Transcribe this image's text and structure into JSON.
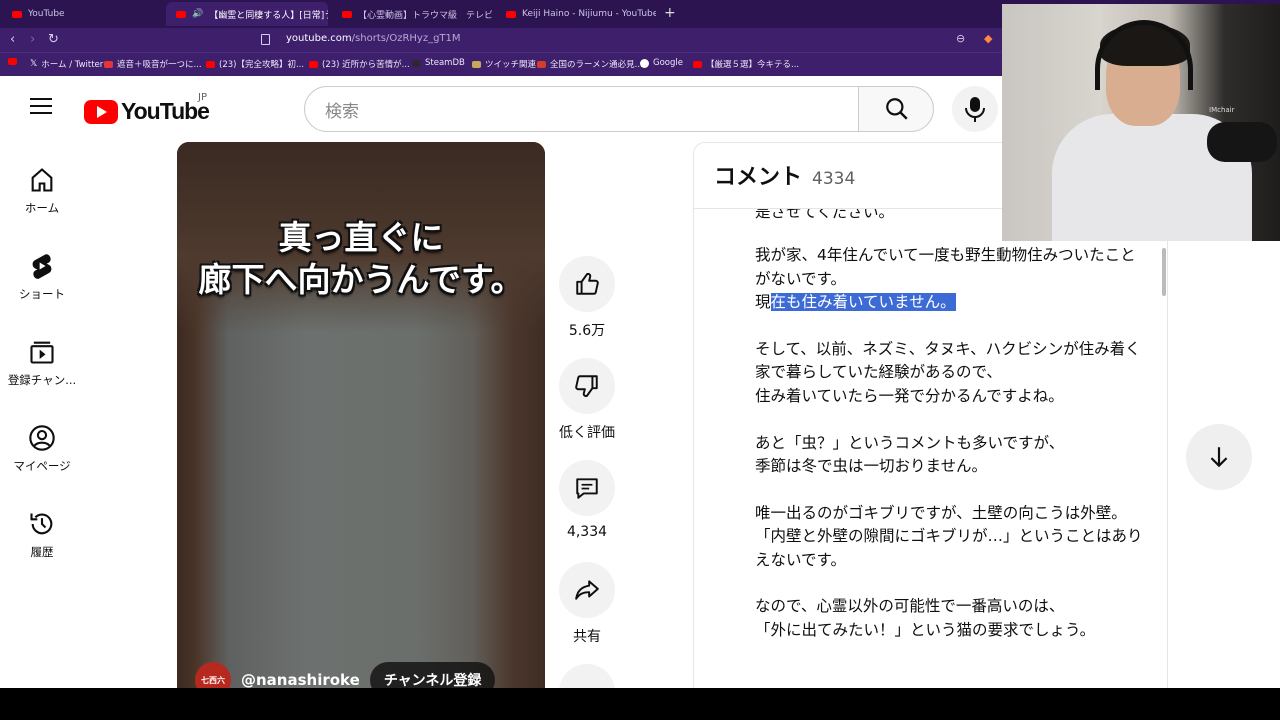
{
  "browser": {
    "tabs": [
      {
        "label": "YouTube",
        "active": false
      },
      {
        "label": "【幽霊と同棲する人】[日常]うち",
        "active": true
      },
      {
        "label": "【心霊動画】トラウマ級　テレビ放送で起",
        "active": false
      },
      {
        "label": "Keiji Haino - Nijiumu - YouTube",
        "active": false
      }
    ],
    "new_tab": "+",
    "close_glyph": "×",
    "url_host": "youtube.com",
    "url_path": "/shorts/OzRHyz_gT1M",
    "bookmarks": [
      {
        "label": "",
        "icon": "youtube"
      },
      {
        "label": "ホーム / Twitter",
        "icon": "x"
      },
      {
        "label": "遮音＋吸音が一つに...",
        "icon": "s"
      },
      {
        "label": "(23)【完全攻略】初...",
        "icon": "youtube"
      },
      {
        "label": "(23) 近所から苦情が...",
        "icon": "youtube"
      },
      {
        "label": "SteamDB",
        "icon": "steam"
      },
      {
        "label": "ツイッチ関連",
        "icon": "folder"
      },
      {
        "label": "全国のラーメン通必見...",
        "icon": "ramen"
      },
      {
        "label": "Google",
        "icon": "google"
      },
      {
        "label": "【厳選５選】今キテる...",
        "icon": "youtube"
      }
    ],
    "colors": {
      "chrome": "#3d1f6b",
      "tabbar": "#2b1450"
    }
  },
  "header": {
    "logo_text": "YouTube",
    "region": "JP",
    "search_placeholder": "検索"
  },
  "sidebar": {
    "items": [
      {
        "label": "ホーム",
        "icon": "home-icon"
      },
      {
        "label": "ショート",
        "icon": "shorts-icon"
      },
      {
        "label": "登録チャン...",
        "icon": "subscriptions-icon"
      },
      {
        "label": "マイページ",
        "icon": "account-icon"
      },
      {
        "label": "履歴",
        "icon": "history-icon"
      }
    ]
  },
  "video": {
    "caption_line1": "真っ直ぐに",
    "caption_line2": "廊下へ向かうんです。",
    "channel_avatar_text": "七西六",
    "channel_handle": "@nanashiroke",
    "subscribe_label": "チャンネル登録"
  },
  "actions": {
    "like_count": "5.6万",
    "dislike_label": "低く評価",
    "comment_count": "4,334",
    "share_label": "共有"
  },
  "comments": {
    "title": "コメント",
    "count": "4334",
    "partial_top": "是させてください。",
    "paragraphs": [
      [
        "我が家、4年住んでいて一度も野生動物住みついたことがないです。"
      ],
      [
        "そして、以前、ネズミ、タヌキ、ハクビシンが住み着く家で暮らしていた経験があるので、",
        "住み着いていたら一発で分かるんですよね。"
      ],
      [
        "あと「虫？」というコメントも多いですが、",
        "季節は冬で虫は一切おりません。"
      ],
      [
        "唯一出るのがゴキブリですが、土壁の向こうは外壁。",
        "「内壁と外壁の隙間にゴキブリが…」ということはありえないです。"
      ],
      [
        "なので、心霊以外の可能性で一番高いのは、",
        "「外に出てみたい！」という猫の要求でしょう。"
      ]
    ],
    "line_current_prefix": "現",
    "line_current_highlight": "在も住み着いていません。",
    "highlight_color": "#3d6bd6"
  },
  "webcam": {
    "overlay_text": "IMchair"
  }
}
